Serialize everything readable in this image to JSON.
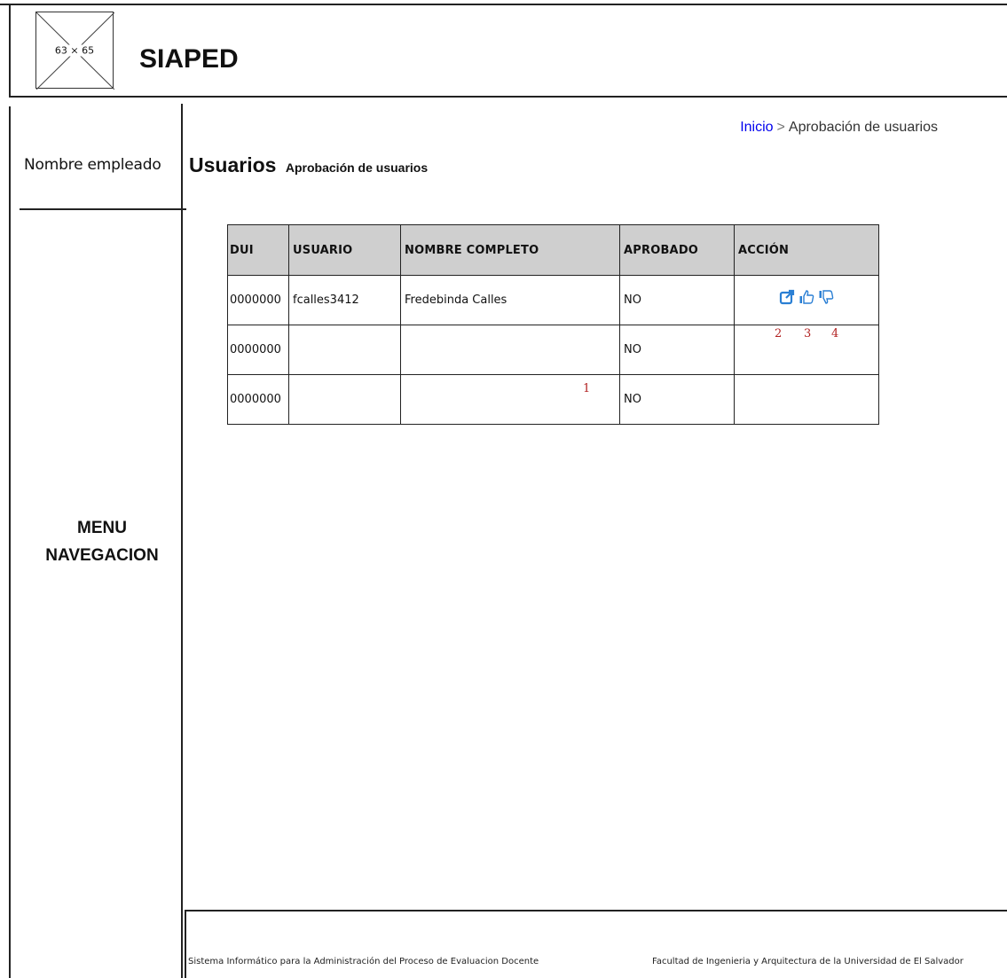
{
  "header": {
    "logo_placeholder": "63 × 65",
    "app_title": "SIAPED"
  },
  "sidebar": {
    "employee_name": "Nombre empleado",
    "menu_label_line1": "MENU",
    "menu_label_line2": "NAVEGACION"
  },
  "breadcrumb": {
    "home": "Inicio",
    "separator": ">",
    "current": "Aprobación de usuarios"
  },
  "page": {
    "title": "Usuarios",
    "subtitle": "Aprobación de usuarios"
  },
  "table": {
    "columns": [
      "DUI",
      "USUARIO",
      "NOMBRE COMPLETO",
      "APROBADO",
      "ACCIÓN"
    ],
    "rows": [
      {
        "dui": "0000000",
        "usuario": "fcalles3412",
        "nombre": "Fredebinda Calles",
        "aprobado": "NO"
      },
      {
        "dui": "0000000",
        "usuario": "",
        "nombre": "",
        "aprobado": "NO"
      },
      {
        "dui": "0000000",
        "usuario": "",
        "nombre": "",
        "aprobado": "NO"
      }
    ],
    "action_icons": [
      "edit-icon",
      "thumbs-up-icon",
      "thumbs-down-icon"
    ]
  },
  "annotations": {
    "marker_1": "1",
    "marker_2": "2",
    "marker_3": "3",
    "marker_4": "4"
  },
  "footer": {
    "left": "Sistema Informático para la Administración del Proceso de Evaluacion Docente",
    "right": "Facultad de Ingenieria y Arquitectura de la Universidad de El Salvador"
  },
  "colors": {
    "link": "#0000ee",
    "icon": "#2a7fd4",
    "callout": "#b22222",
    "table_header_bg": "#cfcfcf"
  }
}
